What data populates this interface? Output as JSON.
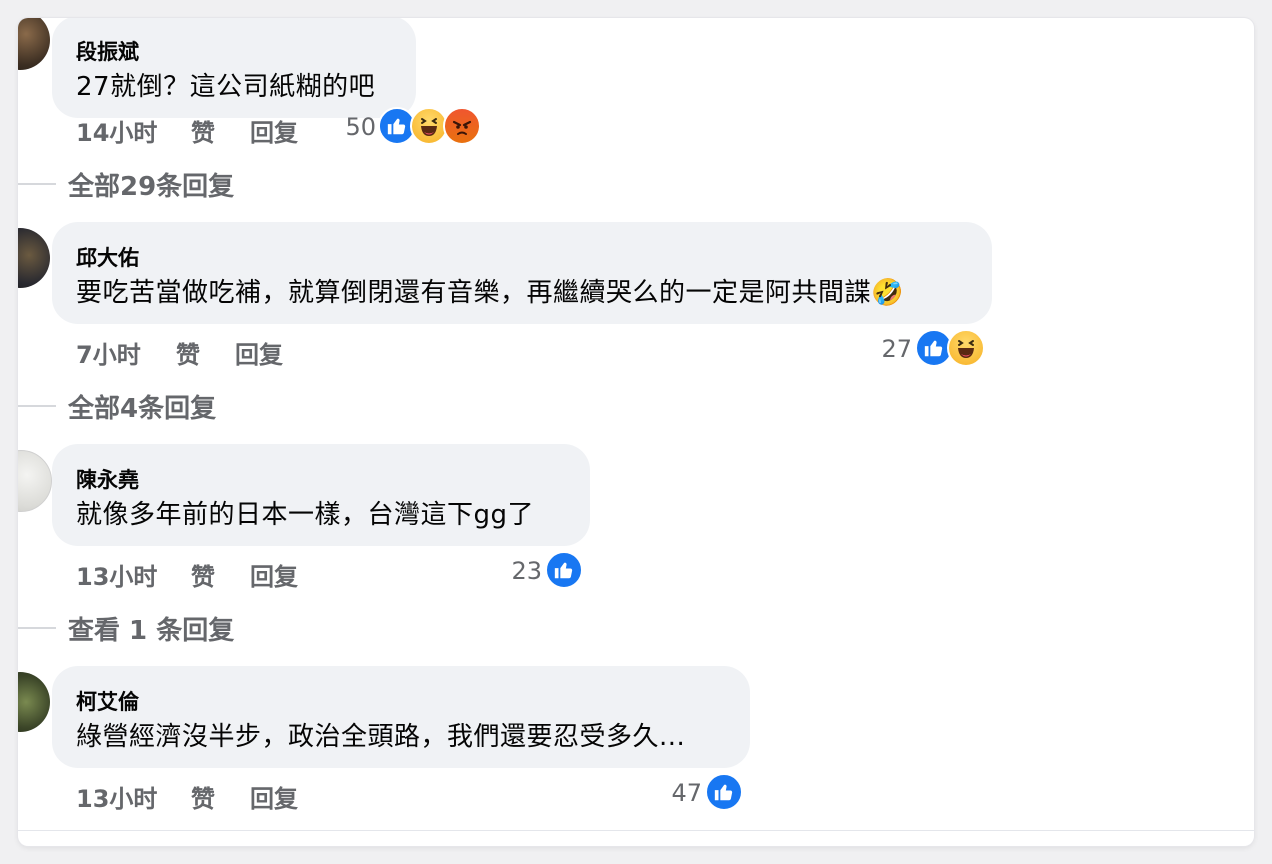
{
  "comments": [
    {
      "author": "段振斌",
      "text": "27就倒？這公司紙糊的吧",
      "time": "14小时",
      "like_label": "赞",
      "reply_label": "回复",
      "reaction_count": "50",
      "reactions": [
        "like",
        "haha",
        "angry"
      ],
      "replies_link": "全部29条回复"
    },
    {
      "author": "邱大佑",
      "text": "要吃苦當做吃補，就算倒閉還有音樂，再繼續哭么的一定是阿共間諜🤣",
      "time": "7小时",
      "like_label": "赞",
      "reply_label": "回复",
      "reaction_count": "27",
      "reactions": [
        "like",
        "haha"
      ],
      "replies_link": "全部4条回复"
    },
    {
      "author": "陳永堯",
      "text": "就像多年前的日本一樣，台灣這下gg了",
      "time": "13小时",
      "like_label": "赞",
      "reply_label": "回复",
      "reaction_count": "23",
      "reactions": [
        "like"
      ],
      "replies_link": "查看 1 条回复"
    },
    {
      "author": "柯艾倫",
      "text": "綠營經濟沒半步，政治全頭路，我們還要忍受多久...",
      "time": "13小时",
      "like_label": "赞",
      "reply_label": "回复",
      "reaction_count": "47",
      "reactions": [
        "like"
      ]
    }
  ],
  "colors": {
    "like_blue": "#1877f2",
    "bubble_bg": "#f0f2f5",
    "meta_gray": "#65676b"
  }
}
